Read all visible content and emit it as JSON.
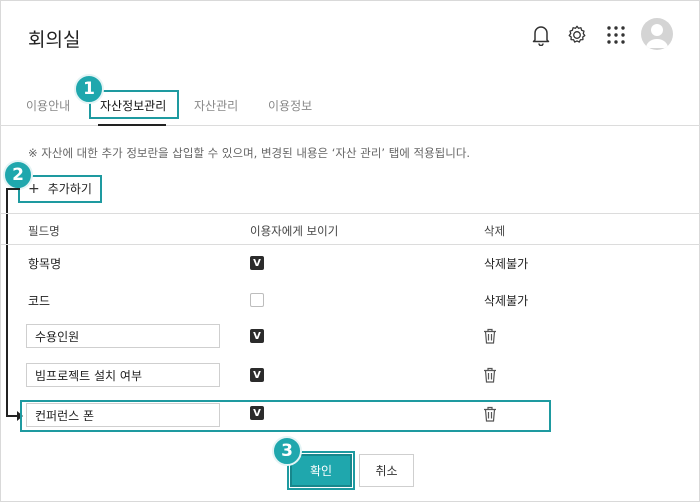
{
  "header": {
    "title": "회의실",
    "icons": [
      "bell-icon",
      "gear-icon",
      "apps-grid-icon",
      "avatar"
    ]
  },
  "tabs": [
    {
      "label": "이용안내",
      "active": false
    },
    {
      "label": "자산정보관리",
      "active": true
    },
    {
      "label": "자산관리",
      "active": false
    },
    {
      "label": "이용정보",
      "active": false
    }
  ],
  "notice": "※ 자산에 대한 추가 정보란을 삽입할 수 있으며, 변경된 내용은 ‘자산 관리’ 탭에 적용됩니다.",
  "add_button": {
    "icon": "+",
    "label": "추가하기"
  },
  "table": {
    "headers": [
      "필드명",
      "이용자에게 보이기",
      "삭제"
    ],
    "rows": [
      {
        "field": "항목명",
        "editable": false,
        "visible": true,
        "delete": "삭제불가"
      },
      {
        "field": "코드",
        "editable": false,
        "visible": false,
        "delete": "삭제불가"
      },
      {
        "field": "수용인원",
        "editable": true,
        "visible": true,
        "delete": "trash-icon"
      },
      {
        "field": "빔프로젝트 설치 여부",
        "editable": true,
        "visible": true,
        "delete": "trash-icon"
      },
      {
        "field": "컨퍼런스 폰",
        "editable": true,
        "visible": true,
        "delete": "trash-icon"
      }
    ],
    "check_mark": "V"
  },
  "badges": [
    "1",
    "2",
    "3"
  ],
  "buttons": {
    "confirm": "확인",
    "cancel": "취소"
  },
  "colors": {
    "accent": "#1fa7ad",
    "highlight": "#1e9aa0",
    "checkbox": "#2b2b2b"
  }
}
